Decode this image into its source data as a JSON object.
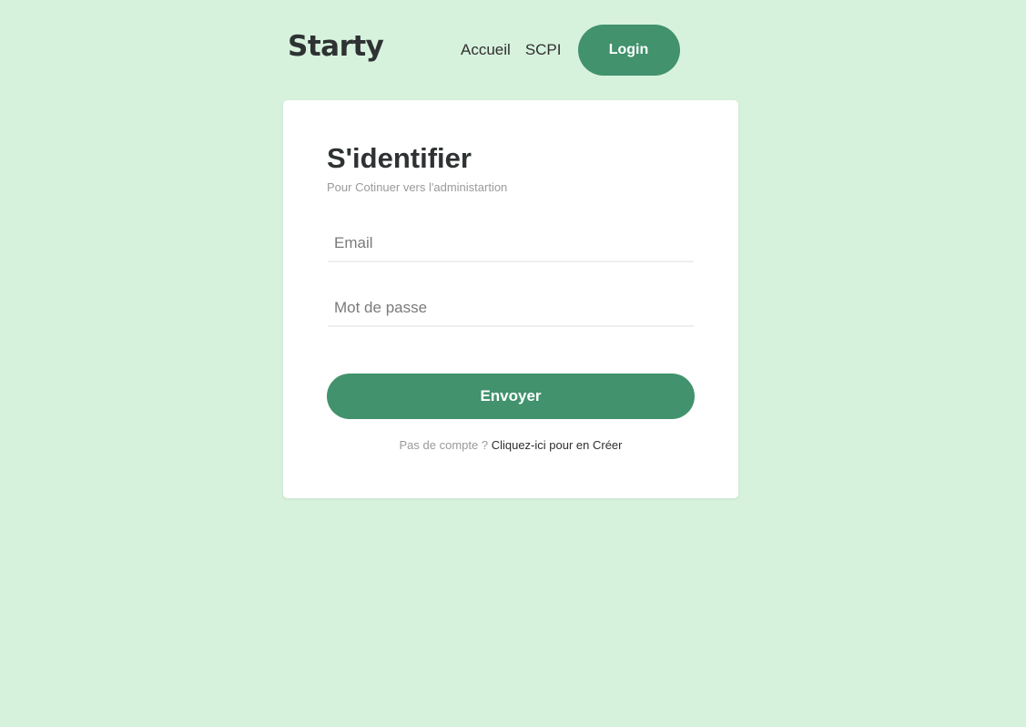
{
  "header": {
    "logo": "Starty",
    "nav": {
      "home_label": "Accueil",
      "scpi_label": "SCPI",
      "login_label": "Login"
    }
  },
  "form": {
    "title": "S'identifier",
    "subtitle": "Pour Cotinuer vers l'administartion",
    "email": {
      "placeholder": "Email",
      "value": ""
    },
    "password": {
      "placeholder": "Mot de passe",
      "value": ""
    },
    "submit_label": "Envoyer",
    "footer": {
      "prompt": "Pas de compte ?",
      "link_label": "Cliquez-ici pour en Créer"
    }
  },
  "colors": {
    "background": "#d7f2dc",
    "accent": "#41926d",
    "card": "#ffffff"
  }
}
